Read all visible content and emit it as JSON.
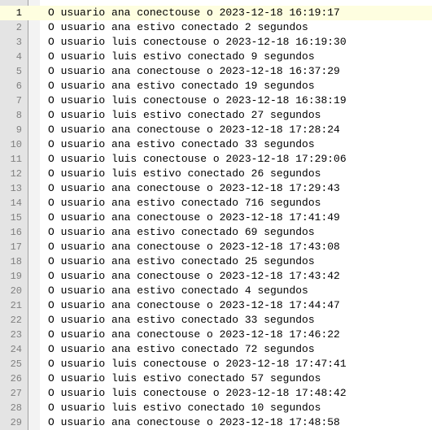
{
  "editor": {
    "lines": [
      {
        "number": "1",
        "text": "O usuario ana conectouse o 2023-12-18 16:19:17"
      },
      {
        "number": "2",
        "text": "O usuario ana estivo conectado 2 segundos"
      },
      {
        "number": "3",
        "text": "O usuario luis conectouse o 2023-12-18 16:19:30"
      },
      {
        "number": "4",
        "text": "O usuario luis estivo conectado 9 segundos"
      },
      {
        "number": "5",
        "text": "O usuario ana conectouse o 2023-12-18 16:37:29"
      },
      {
        "number": "6",
        "text": "O usuario ana estivo conectado 19 segundos"
      },
      {
        "number": "7",
        "text": "O usuario luis conectouse o 2023-12-18 16:38:19"
      },
      {
        "number": "8",
        "text": "O usuario luis estivo conectado 27 segundos"
      },
      {
        "number": "9",
        "text": "O usuario ana conectouse o 2023-12-18 17:28:24"
      },
      {
        "number": "10",
        "text": "O usuario ana estivo conectado 33 segundos"
      },
      {
        "number": "11",
        "text": "O usuario luis conectouse o 2023-12-18 17:29:06"
      },
      {
        "number": "12",
        "text": "O usuario luis estivo conectado 26 segundos"
      },
      {
        "number": "13",
        "text": "O usuario ana conectouse o 2023-12-18 17:29:43"
      },
      {
        "number": "14",
        "text": "O usuario ana estivo conectado 716 segundos"
      },
      {
        "number": "15",
        "text": "O usuario ana conectouse o 2023-12-18 17:41:49"
      },
      {
        "number": "16",
        "text": "O usuario ana estivo conectado 69 segundos"
      },
      {
        "number": "17",
        "text": "O usuario ana conectouse o 2023-12-18 17:43:08"
      },
      {
        "number": "18",
        "text": "O usuario ana estivo conectado 25 segundos"
      },
      {
        "number": "19",
        "text": "O usuario ana conectouse o 2023-12-18 17:43:42"
      },
      {
        "number": "20",
        "text": "O usuario ana estivo conectado 4 segundos"
      },
      {
        "number": "21",
        "text": "O usuario ana conectouse o 2023-12-18 17:44:47"
      },
      {
        "number": "22",
        "text": "O usuario ana estivo conectado 33 segundos"
      },
      {
        "number": "23",
        "text": "O usuario ana conectouse o 2023-12-18 17:46:22"
      },
      {
        "number": "24",
        "text": "O usuario ana estivo conectado 72 segundos"
      },
      {
        "number": "25",
        "text": "O usuario luis conectouse o 2023-12-18 17:47:41"
      },
      {
        "number": "26",
        "text": "O usuario luis estivo conectado 57 segundos"
      },
      {
        "number": "27",
        "text": "O usuario luis conectouse o 2023-12-18 17:48:42"
      },
      {
        "number": "28",
        "text": "O usuario luis estivo conectado 10 segundos"
      },
      {
        "number": "29",
        "text": "O usuario ana conectouse o 2023-12-18 17:48:58"
      }
    ]
  }
}
